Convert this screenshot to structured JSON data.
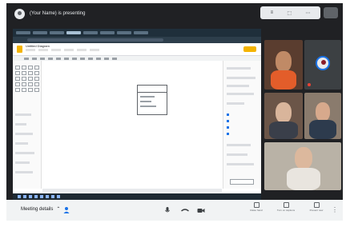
{
  "presenter": {
    "text": "(Your Name) is presenting"
  },
  "top_controls": {
    "items": [
      "≡",
      "⬚",
      "⋯"
    ]
  },
  "shared_screen": {
    "doc_title": "Untitled Diagram",
    "menu_items": [
      "File",
      "Edit",
      "View",
      "Arrange",
      "Extras",
      "Help"
    ]
  },
  "participants": [
    {
      "name": ""
    },
    {
      "name": ""
    },
    {
      "name": ""
    },
    {
      "name": ""
    },
    {
      "name": ""
    }
  ],
  "bottom_bar": {
    "meeting_details_label": "Meeting details",
    "chevron": "⌃",
    "actions": [
      {
        "label": "Raise hand"
      },
      {
        "label": "Turn on captions"
      },
      {
        "label": "Present now"
      }
    ],
    "more": "⋮"
  },
  "colors": {
    "background": "#202124",
    "accent": "#1a73e8",
    "doc_accent": "#f4b400",
    "bottom_bar": "#f1f3f4"
  },
  "icons": [
    "person-icon",
    "mic-icon",
    "camera-icon",
    "hangup-icon",
    "hand-icon",
    "captions-icon",
    "present-icon",
    "more-vert-icon"
  ]
}
